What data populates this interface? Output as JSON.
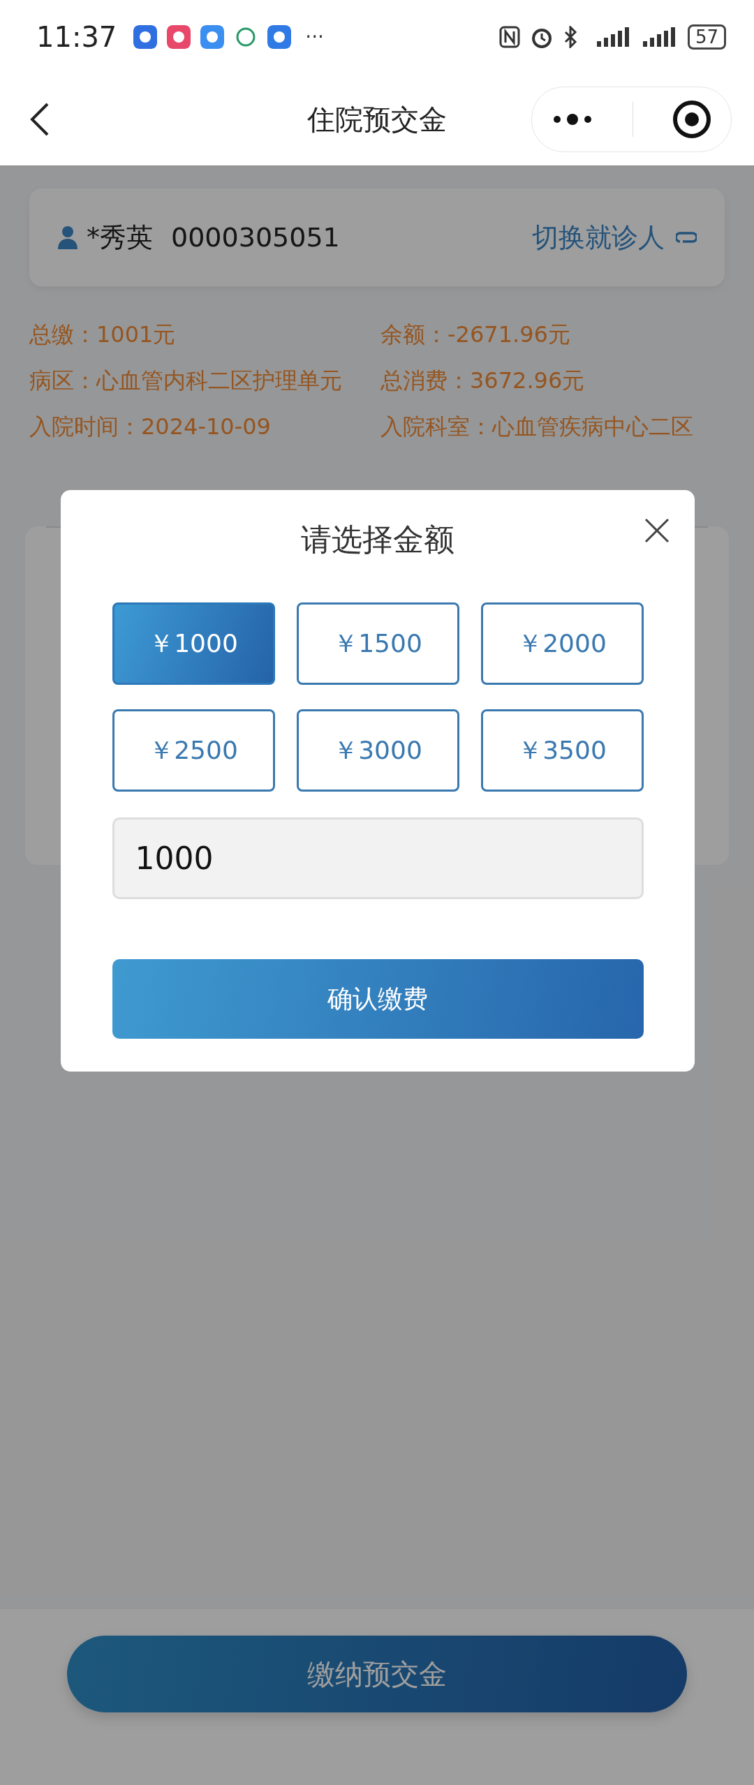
{
  "status_bar": {
    "time": "11:37",
    "more": "···",
    "battery": "57"
  },
  "nav": {
    "title": "住院预交金"
  },
  "patient": {
    "name": "*秀英",
    "id": "0000305051",
    "switch_label": "切换就诊人"
  },
  "summary": [
    "总缴：1001元",
    "余额：-2671.96元",
    "病区：心血管内科二区护理单元",
    "总消费：3672.96元",
    "入院时间：2024-10-09",
    "入院科室：心血管疾病中心二区"
  ],
  "modal": {
    "title": "请选择金额",
    "amounts": [
      {
        "label": "￥1000",
        "selected": true
      },
      {
        "label": "￥1500",
        "selected": false
      },
      {
        "label": "￥2000",
        "selected": false
      },
      {
        "label": "￥2500",
        "selected": false
      },
      {
        "label": "￥3000",
        "selected": false
      },
      {
        "label": "￥3500",
        "selected": false
      }
    ],
    "amount_field": {
      "value": "1000"
    },
    "confirm": "确认缴费"
  },
  "bottom_button": "缴纳预交金"
}
